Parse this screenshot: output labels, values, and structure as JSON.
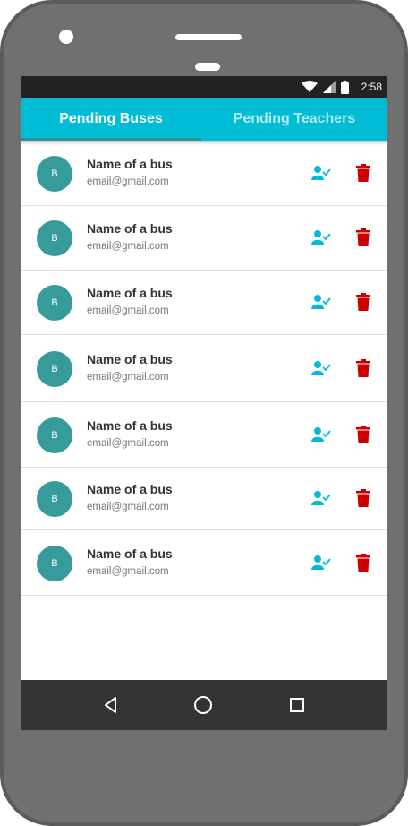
{
  "status_bar": {
    "time": "2:58",
    "icons": [
      "wifi-icon",
      "signal-icon",
      "battery-icon"
    ]
  },
  "tabs": [
    {
      "label": "Pending Buses",
      "active": true
    },
    {
      "label": "Pending Teachers",
      "active": false
    }
  ],
  "items": [
    {
      "avatar": "B",
      "name": "Name of a bus",
      "email": "email@gmail.com"
    },
    {
      "avatar": "B",
      "name": "Name of a bus",
      "email": "email@gmail.com"
    },
    {
      "avatar": "B",
      "name": "Name of a bus",
      "email": "email@gmail.com"
    },
    {
      "avatar": "B",
      "name": "Name of a bus",
      "email": "email@gmail.com"
    },
    {
      "avatar": "B",
      "name": "Name of a bus",
      "email": "email@gmail.com"
    },
    {
      "avatar": "B",
      "name": "Name of a bus",
      "email": "email@gmail.com"
    },
    {
      "avatar": "B",
      "name": "Name of a bus",
      "email": "email@gmail.com"
    }
  ],
  "nav_bar": {
    "icons": [
      "back-icon",
      "home-icon",
      "recents-icon"
    ]
  },
  "colors": {
    "primary": "#00bcd4",
    "avatar": "#369b9a",
    "approve": "#00bcd4",
    "delete": "#cc0000",
    "nav": "#333333"
  }
}
